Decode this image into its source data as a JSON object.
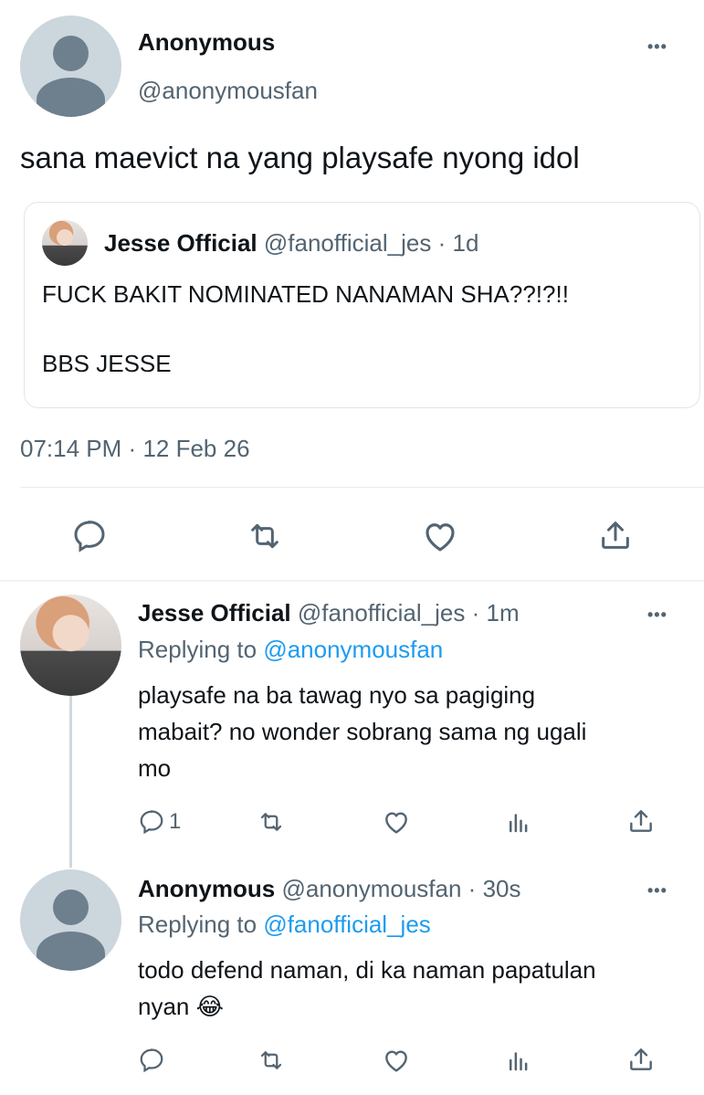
{
  "main_tweet": {
    "author_name": "Anonymous",
    "author_handle": "@anonymousfan",
    "text": "sana maevict na yang playsafe nyong idol",
    "timestamp_time": "07:14 PM",
    "timestamp_date": "12 Feb 26",
    "separator": "·",
    "more_label": "•••"
  },
  "quoted_tweet": {
    "author_name": "Jesse Official",
    "author_handle": "@fanofficial_jes",
    "age": "1d",
    "line1": "FUCK BAKIT NOMINATED NANAMAN SHA??!?!!",
    "line2": "BBS JESSE"
  },
  "reply1": {
    "author_name": "Jesse Official",
    "author_handle": "@fanofficial_jes",
    "age": "1m",
    "replying_prefix": "Replying to",
    "replying_to": "@anonymousfan",
    "text_line1": "playsafe na ba tawag nyo sa pagiging",
    "text_line2": "mabait? no wonder sobrang sama ng ugali",
    "text_line3": "mo",
    "reply_count": "1",
    "more_label": "•••"
  },
  "reply2": {
    "author_name": "Anonymous",
    "author_handle": "@anonymousfan",
    "age": "30s",
    "replying_prefix": "Replying to",
    "replying_to": "@fanofficial_jes",
    "text_line1": "todo defend naman, di ka naman papatulan",
    "text_line2": "nyan",
    "emoji": "😂",
    "more_label": "•••"
  },
  "icons": [
    "reply-icon",
    "retweet-icon",
    "like-icon",
    "share-icon",
    "analytics-icon",
    "more-icon"
  ],
  "colors": {
    "link": "#1d9bf0",
    "muted": "#536471",
    "text": "#0f1419"
  }
}
